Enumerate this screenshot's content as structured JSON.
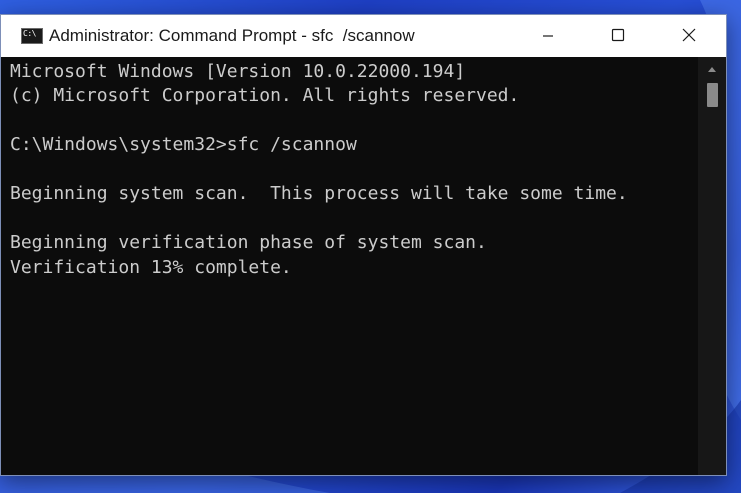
{
  "window": {
    "title": "Administrator: Command Prompt - sfc  /scannow",
    "icon_label": "C:\\"
  },
  "console": {
    "lines": [
      "Microsoft Windows [Version 10.0.22000.194]",
      "(c) Microsoft Corporation. All rights reserved.",
      "",
      "C:\\Windows\\system32>sfc /scannow",
      "",
      "Beginning system scan.  This process will take some time.",
      "",
      "Beginning verification phase of system scan.",
      "Verification 13% complete."
    ]
  },
  "icons": {
    "minimize": "minimize-icon",
    "maximize": "maximize-icon",
    "close": "close-icon",
    "scroll_up": "scroll-up-arrow-icon"
  },
  "colors": {
    "console_background": "#0c0c0c",
    "console_text": "#cccccc",
    "titlebar": "#ffffff",
    "desktop": "#274fd6"
  }
}
